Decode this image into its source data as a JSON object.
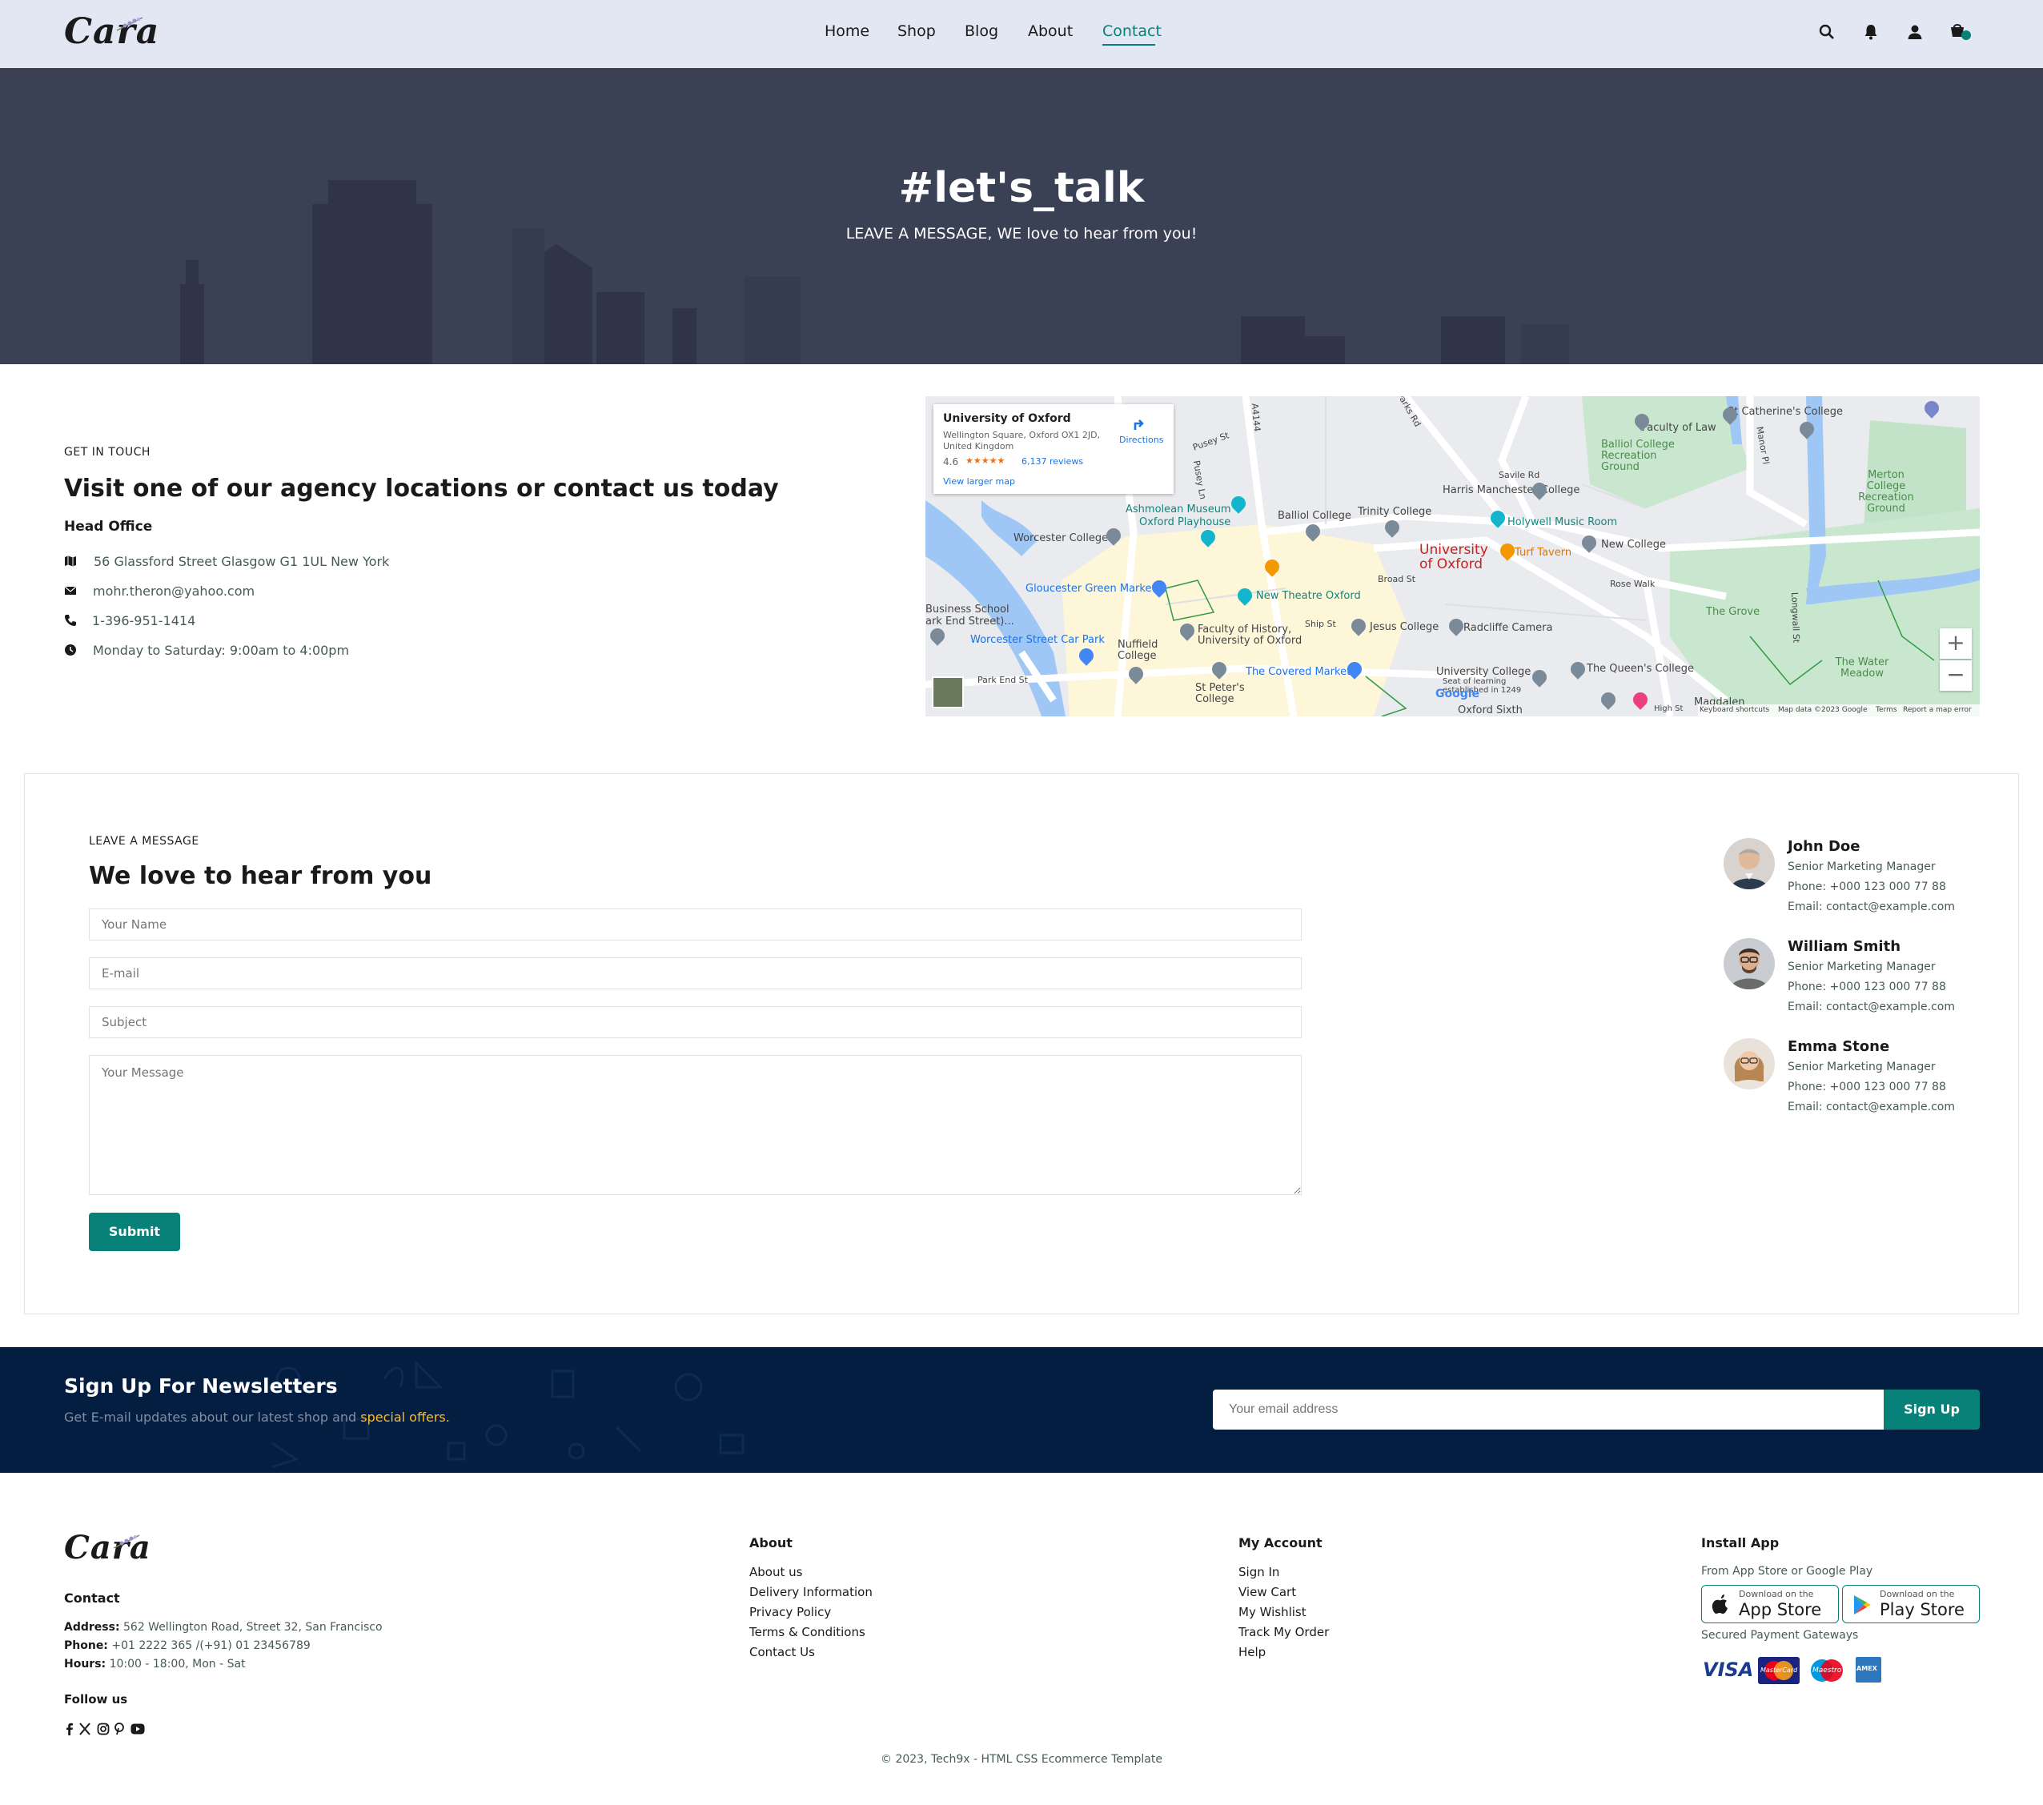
{
  "header": {
    "logo": "Cara",
    "nav": [
      "Home",
      "Shop",
      "Blog",
      "About",
      "Contact"
    ],
    "active": "Contact",
    "icons": [
      "search-icon",
      "bell-icon",
      "user-icon",
      "cart-icon"
    ]
  },
  "hero": {
    "title": "#let's_talk",
    "subtitle": "LEAVE A MESSAGE, WE love to hear from you!"
  },
  "contact": {
    "kicker": "GET IN TOUCH",
    "heading": "Visit one of our agency locations or contact us today",
    "office_title": "Head Office",
    "address": "56 Glassford Street Glasgow G1 1UL New York",
    "email": "mohr.theron@yahoo.com",
    "phone": "1-396-951-1414",
    "hours": "Monday to Saturday: 9:00am to 4:00pm"
  },
  "map": {
    "place_name": "University of Oxford",
    "place_address_1": "Wellington Square, Oxford OX1 2JD,",
    "place_address_2": "United Kingdom",
    "rating": "4.6",
    "stars": "★★★★★",
    "reviews": "6,137 reviews",
    "directions": "Directions",
    "larger_map": "View larger map",
    "labels": {
      "st_catherines": "St Catherine's College",
      "faculty_of_law": "Faculty of Law",
      "balliol_rec": "Balliol College Recreation Ground",
      "merton_rec": "Merton College Recreation Ground",
      "ashmolean": "Ashmolean Museum",
      "playhouse": "Oxford Playhouse",
      "worcester": "Worcester College",
      "balliol": "Balliol College",
      "trinity": "Trinity College",
      "harris": "Harris Manchester College",
      "savile": "Savile Rd",
      "holywell": "Holywell Music Room",
      "uni_oxford": "University of Oxford",
      "turf": "Turf Tavern",
      "new_college": "New College",
      "broad_st": "Broad St",
      "rose_walk": "Rose Walk",
      "gloucester": "Gloucester Green Market",
      "new_theatre": "New Theatre Oxford",
      "grove": "The Grove",
      "business_school": "Business School",
      "end_street": "ark End Street)...",
      "faculty_history": "Faculty of History,",
      "faculty_history_2": "University of Oxford",
      "jesus": "Jesus College",
      "radcliffe": "Radcliffe Camera",
      "ship_st": "Ship St",
      "worcester_park": "Worcester Street Car Park",
      "nuffield": "Nuffield College",
      "covered_market": "The Covered Market",
      "univ_college": "University College",
      "queens": "The Queen's College",
      "water_meadow": "The Water Meadow",
      "park_end": "Park End St",
      "st_peters": "St Peter's College",
      "oxford_sixth": "Oxford Sixth",
      "magdalen": "Magdalen",
      "high_st": "High St",
      "pusey": "Pusey St",
      "pusey_ln": "Pusey Ln",
      "a4144": "A4144",
      "longwall": "Longwall St",
      "manor": "Manor Pl",
      "parks_rd": "Parks Rd",
      "seat": "Seat of learning",
      "established": "established in 1249"
    },
    "attribution": [
      "Keyboard shortcuts",
      "Map data ©2023 Google",
      "Terms",
      "Report a map error"
    ],
    "google": "Google"
  },
  "form": {
    "kicker": "LEAVE A MESSAGE",
    "heading": "We love to hear from you",
    "name_placeholder": "Your Name",
    "email_placeholder": "E-mail",
    "subject_placeholder": "Subject",
    "message_placeholder": "Your Message",
    "submit": "Submit"
  },
  "people": [
    {
      "name": "John Doe",
      "role": "Senior Marketing Manager",
      "phone": "Phone: +000 123 000 77 88",
      "email": "Email: contact@example.com"
    },
    {
      "name": "William Smith",
      "role": "Senior Marketing Manager",
      "phone": "Phone: +000 123 000 77 88",
      "email": "Email: contact@example.com"
    },
    {
      "name": "Emma Stone",
      "role": "Senior Marketing Manager",
      "phone": "Phone: +000 123 000 77 88",
      "email": "Email: contact@example.com"
    }
  ],
  "newsletter": {
    "title": "Sign Up For Newsletters",
    "text": "Get E-mail updates about our latest shop and",
    "highlight": "special offers.",
    "placeholder": "Your email address",
    "button": "Sign Up"
  },
  "footer": {
    "logo": "Cara",
    "contact_title": "Contact",
    "address_label": "Address:",
    "address": "562 Wellington Road, Street 32, San Francisco",
    "phone_label": "Phone:",
    "phone": "+01 2222 365 /(+91) 01 23456789",
    "hours_label": "Hours:",
    "hours": "10:00 - 18:00, Mon - Sat",
    "follow": "Follow us",
    "about_title": "About",
    "about_links": [
      "About us",
      "Delivery Information",
      "Privacy Policy",
      "Terms & Conditions",
      "Contact Us"
    ],
    "account_title": "My Account",
    "account_links": [
      "Sign In",
      "View Cart",
      "My Wishlist",
      "Track My Order",
      "Help"
    ],
    "install_title": "Install App",
    "install_text": "From App Store or Google Play",
    "appstore_small": "Download on the",
    "appstore_big": "App Store",
    "playstore_small": "Download on the",
    "playstore_big": "Play Store",
    "payments_text": "Secured Payment Gateways",
    "payments": [
      "VISA",
      "MasterCard",
      "Maestro",
      "AMEX"
    ],
    "copyright": "© 2023, Tech9x - HTML CSS Ecommerce Template"
  },
  "colors": {
    "accent": "#088178",
    "header_bg": "#e3e6f3",
    "hero_bg": "#3b4154",
    "newsletter_bg": "#041e42",
    "highlight": "#ffbd27"
  }
}
